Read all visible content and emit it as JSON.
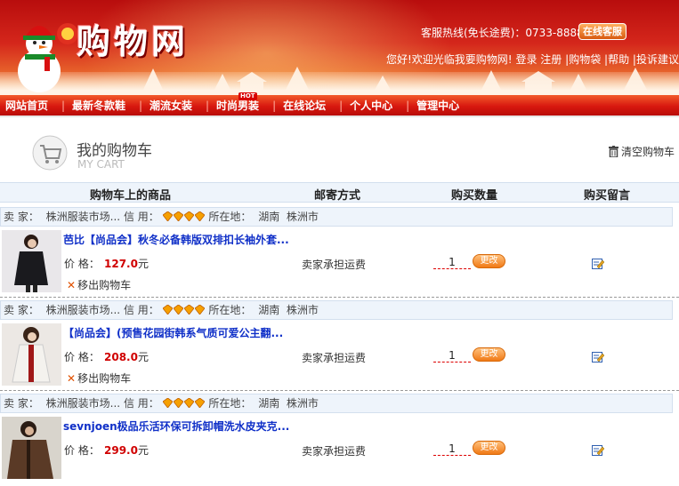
{
  "header": {
    "logo": "购物网",
    "hotline": "客服热线(免长途费)：0733-8888888",
    "online_service": "在线客服",
    "welcome": "您好!欢迎光临我要购物网!",
    "links": [
      "登录",
      "注册",
      "购物袋",
      "帮助",
      "投诉建议"
    ]
  },
  "nav": {
    "items": [
      "网站首页",
      "最新冬款鞋",
      "潮流女装",
      "时尚男装",
      "在线论坛",
      "个人中心",
      "管理中心"
    ],
    "hot_badge": "HOT"
  },
  "cart": {
    "title": "我的购物车",
    "subtitle": "MY CART",
    "clear": "清空购物车"
  },
  "table": {
    "columns": [
      "购物车上的商品",
      "邮寄方式",
      "购买数量",
      "购买留言"
    ]
  },
  "labels": {
    "seller": "卖 家：",
    "credit": "信 用：",
    "location": "所在地：",
    "price": "价 格：",
    "remove": "移出购物车",
    "change": "更改",
    "currency": "元"
  },
  "items": [
    {
      "seller": "株洲服装市场...",
      "location": "湖南  株洲市",
      "name": "芭比【尚品会】秋冬必备韩版双排扣长袖外套...",
      "price": "127.0",
      "shipping": "卖家承担运费",
      "quantity": "1"
    },
    {
      "seller": "株洲服装市场...",
      "location": "湖南  株洲市",
      "name": "【尚品会】(预售花园街韩系气质可爱公主翻...",
      "price": "208.0",
      "shipping": "卖家承担运费",
      "quantity": "1"
    },
    {
      "seller": "株洲服装市场...",
      "location": "湖南  株洲市",
      "name": "sevnjoen极品乐活环保可拆卸帽洗水皮夹克...",
      "price": "299.0",
      "shipping": "卖家承担运费",
      "quantity": "1"
    }
  ],
  "colors": {
    "accent_red": "#d8180f",
    "link_blue": "#1030c8",
    "price_red": "#d00000",
    "row_bg": "#eef4fb"
  }
}
